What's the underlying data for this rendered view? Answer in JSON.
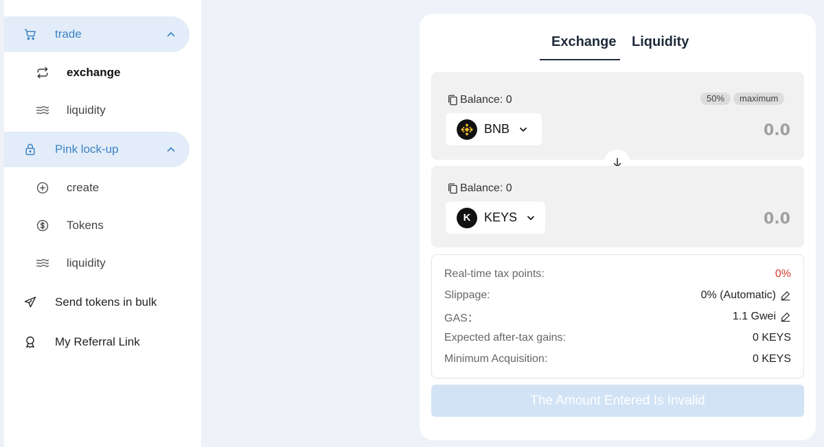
{
  "sidebar": {
    "trade": {
      "label": "trade",
      "icon": "cart-icon"
    },
    "trade_items": [
      {
        "label": "exchange",
        "icon": "swap-arrows-icon",
        "active": true
      },
      {
        "label": "liquidity",
        "icon": "waves-icon"
      }
    ],
    "pink_lockup": {
      "label": "Pink lock-up",
      "icon": "lock-icon"
    },
    "lockup_items": [
      {
        "label": "create",
        "icon": "plus-circle-icon"
      },
      {
        "label": "Tokens",
        "icon": "dollar-circle-icon"
      },
      {
        "label": "liquidity",
        "icon": "waves-icon"
      }
    ],
    "send_bulk": {
      "label": "Send tokens in bulk",
      "icon": "send-icon"
    },
    "referral": {
      "label": "My Referral Link",
      "icon": "award-icon"
    }
  },
  "tabs": {
    "exchange": "Exchange",
    "liquidity": "Liquidity"
  },
  "from": {
    "balance": "Balance: 0",
    "pct_50": "50%",
    "maximum": "maximum",
    "token": "BNB",
    "amount": "0.0"
  },
  "to": {
    "balance": "Balance: 0",
    "token": "KEYS",
    "token_logo_letter": "K",
    "amount": "0.0"
  },
  "info": {
    "tax_label": "Real-time tax points:",
    "tax_value": "0%",
    "slippage_label": "Slippage:",
    "slippage_value": "0% (Automatic)",
    "gas_label": "GAS：",
    "gas_value": "1.1 Gwei",
    "expected_label": "Expected after-tax gains:",
    "expected_value": "0 KEYS",
    "minimum_label": "Minimum Acquisition:",
    "minimum_value": "0 KEYS"
  },
  "submit_label": "The Amount Entered Is Invalid",
  "colors": {
    "accent": "#3b82c4",
    "group_bg": "#e3edf9",
    "tax_red": "#d9392f",
    "submit_bg": "#d2e3f6",
    "bnb_yellow": "#f3ba2f"
  }
}
